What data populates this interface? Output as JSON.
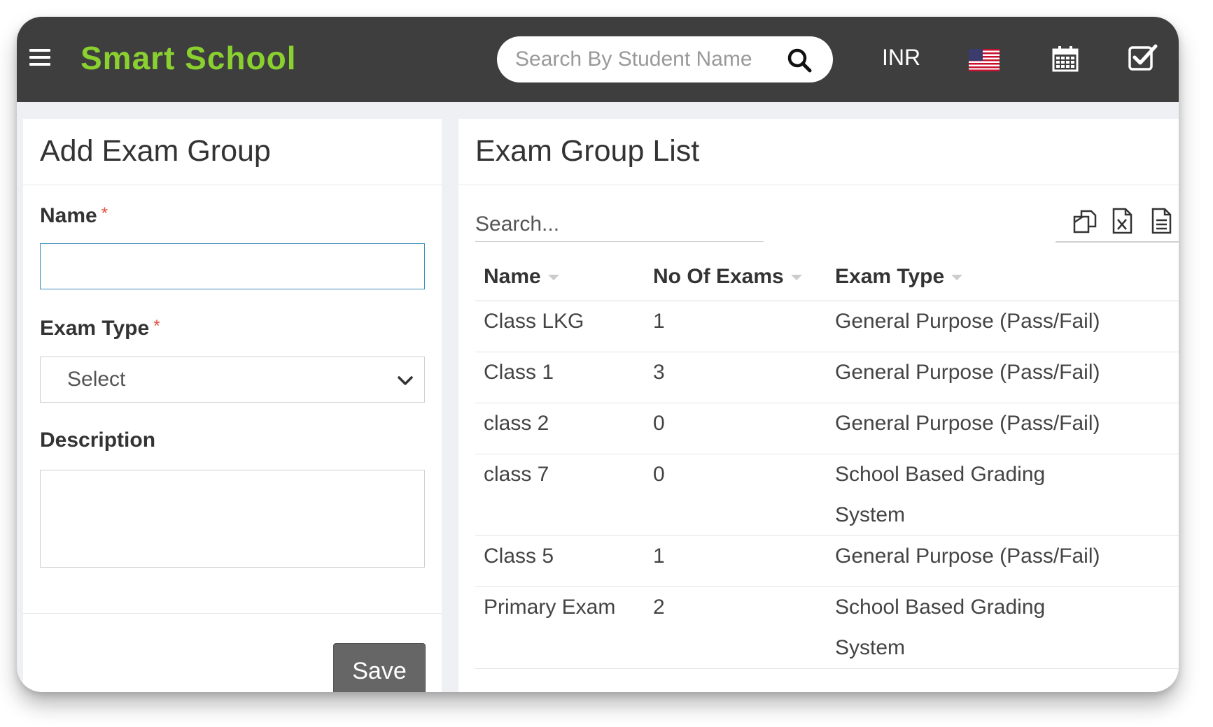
{
  "app": {
    "title": "Smart School",
    "title_color": "#8ad130",
    "topbar_color": "#3e3e3e",
    "menu_icon": "hamburger-icon"
  },
  "header": {
    "search_placeholder": "Search By Student Name",
    "search_icon": "search-icon",
    "currency": "INR",
    "language_icon": "us-flag-icon",
    "calendar_icon": "calendar-icon",
    "tasks_icon": "checkbox-icon"
  },
  "add_form": {
    "title": "Add Exam Group",
    "name_label": "Name",
    "name_value": "",
    "required_mark": "*",
    "exam_type_label": "Exam Type",
    "exam_type_selected": "Select",
    "description_label": "Description",
    "description_value": "",
    "save_label": "Save"
  },
  "list": {
    "title": "Exam Group List",
    "search_placeholder": "Search...",
    "tools": [
      "copy-icon",
      "excel-icon",
      "document-icon"
    ],
    "columns": [
      "Name",
      "No Of Exams",
      "Exam Type"
    ],
    "rows": [
      {
        "name": "Class LKG",
        "count": "1",
        "type": "General Purpose (Pass/Fail)"
      },
      {
        "name": "Class 1",
        "count": "3",
        "type": "General Purpose (Pass/Fail)"
      },
      {
        "name": "class 2",
        "count": "0",
        "type": "General Purpose (Pass/Fail)"
      },
      {
        "name": "class 7",
        "count": "0",
        "type": "School Based Grading System"
      },
      {
        "name": "Class 5",
        "count": "1",
        "type": "General Purpose (Pass/Fail)"
      },
      {
        "name": "Primary Exam",
        "count": "2",
        "type": "School Based Grading System"
      }
    ]
  }
}
